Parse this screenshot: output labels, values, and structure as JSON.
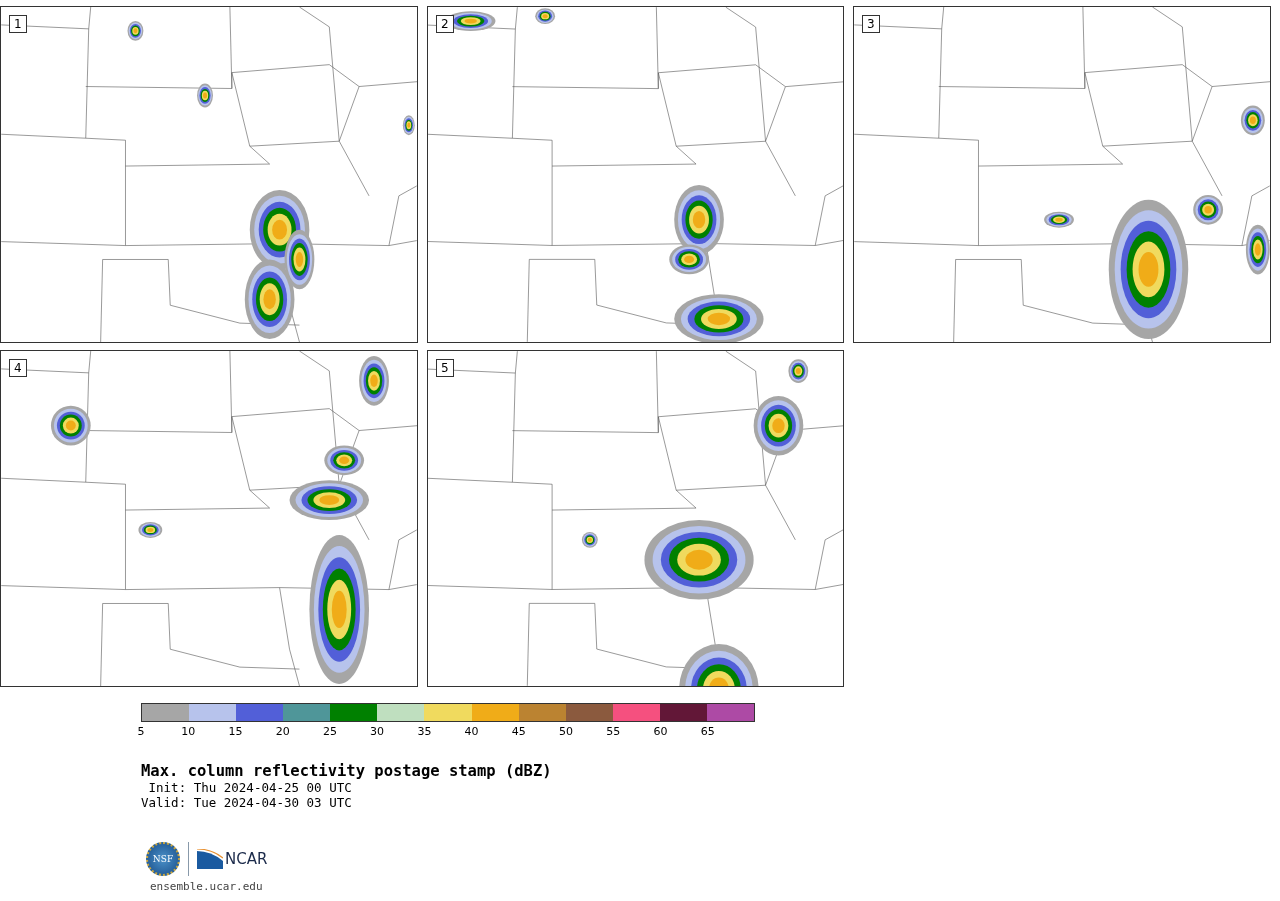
{
  "panels": [
    {
      "label": "1"
    },
    {
      "label": "2"
    },
    {
      "label": "3"
    },
    {
      "label": "4"
    },
    {
      "label": "5"
    }
  ],
  "colorbar": {
    "segments": [
      {
        "color": "#a6a6a6"
      },
      {
        "color": "#b7c3ec"
      },
      {
        "color": "#525fd8"
      },
      {
        "color": "#4f9699"
      },
      {
        "color": "#008000"
      },
      {
        "color": "#bfdfbf"
      },
      {
        "color": "#f0da5e"
      },
      {
        "color": "#f0ac18"
      },
      {
        "color": "#bb8331"
      },
      {
        "color": "#8b5a3e"
      },
      {
        "color": "#f5507f"
      },
      {
        "color": "#621737"
      },
      {
        "color": "#ad4aa5"
      }
    ],
    "ticks": [
      "5",
      "10",
      "15",
      "20",
      "25",
      "30",
      "35",
      "40",
      "45",
      "50",
      "55",
      "60",
      "65"
    ]
  },
  "title": "Max. column reflectivity postage stamp (dBZ)",
  "init": " Init: Thu 2024-04-25 00 UTC",
  "valid": "Valid: Tue 2024-04-30 03 UTC",
  "logos": {
    "nsf": "NSF",
    "ncar": "NCAR"
  },
  "url": "ensemble.ucar.edu"
}
